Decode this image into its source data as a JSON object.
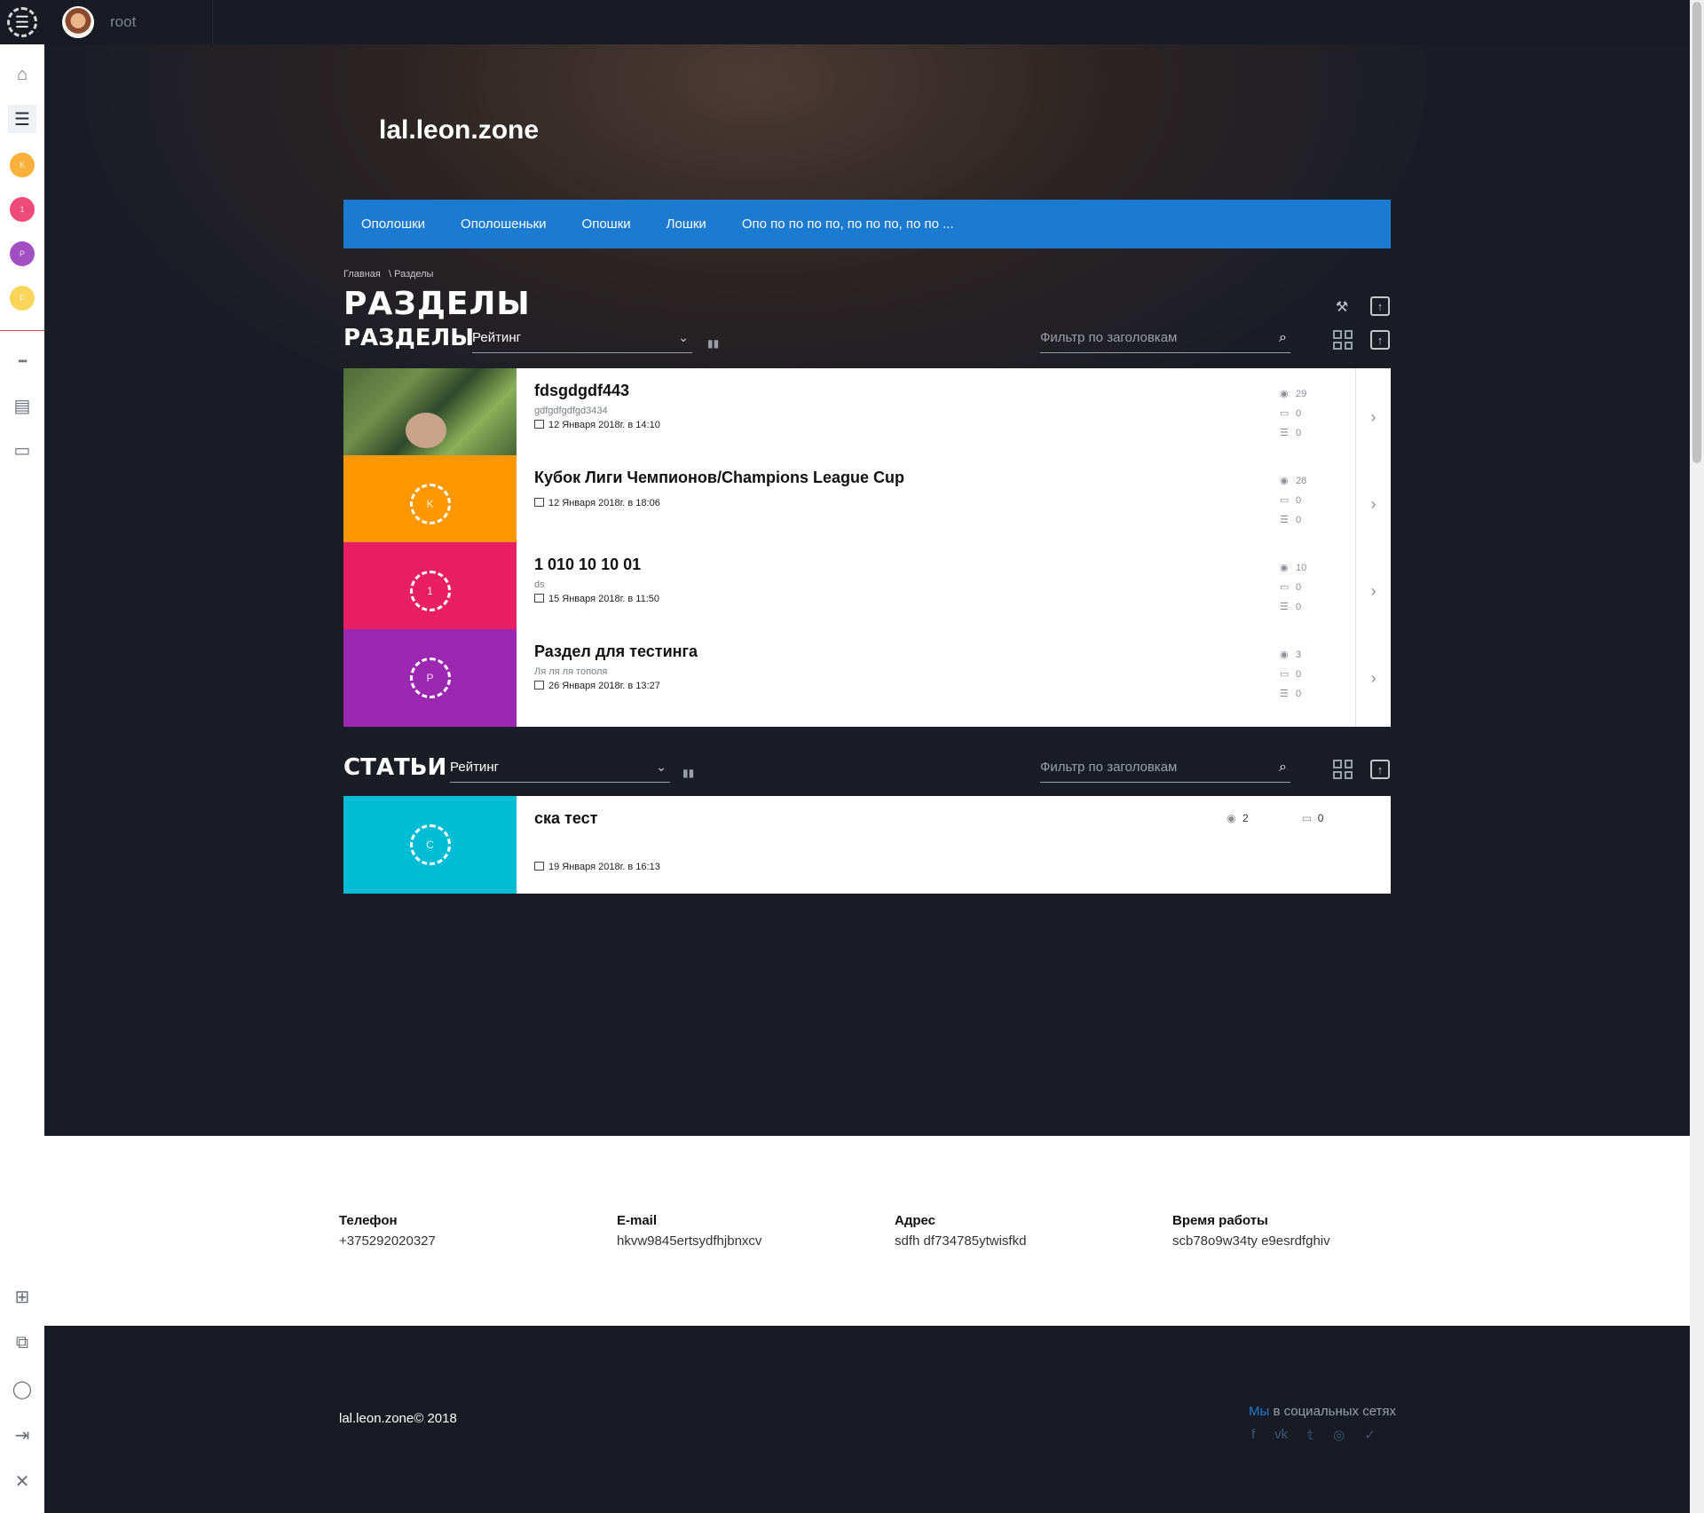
{
  "topbar": {
    "user_name": "root"
  },
  "sidebar": {
    "dots": [
      {
        "letter": "K",
        "color": "#fbb03b"
      },
      {
        "letter": "1",
        "color": "#ee4a7c"
      },
      {
        "letter": "P",
        "color": "#a24fc4"
      },
      {
        "letter": "F",
        "color": "#fbd55a"
      }
    ]
  },
  "site": {
    "title": "lal.leon.zone",
    "nav": [
      "Ополошки",
      "Ополошеньки",
      "Опошки",
      "Лошки",
      "Опо по по по по, по по по, по по ..."
    ]
  },
  "breadcrumb": {
    "home": "Главная",
    "sep": "\\",
    "current": "Разделы"
  },
  "page_title": "РАЗДЕЛЫ",
  "sections_block": {
    "title": "РАЗДЕЛЫ",
    "sort_label": "Рейтинг",
    "filter_placeholder": "Фильтр по заголовкам",
    "items": [
      {
        "title": "fdsgdgdf443",
        "subtitle": "gdfgdfgdfgd3434",
        "date": "12 Января 2018г. в 14:10",
        "views": "29",
        "comments": "0",
        "items": "0",
        "thumb": "photo",
        "letter": "",
        "color": ""
      },
      {
        "title": "Кубок Лиги Чемпионов/Champions League Cup",
        "subtitle": "",
        "date": "12 Января 2018г. в 18:06",
        "views": "28",
        "comments": "0",
        "items": "0",
        "thumb": "ring",
        "letter": "K",
        "color": "#ff9800"
      },
      {
        "title": "1 010 10 10 01",
        "subtitle": "ds",
        "date": "15 Января 2018г. в 11:50",
        "views": "10",
        "comments": "0",
        "items": "0",
        "thumb": "ring",
        "letter": "1",
        "color": "#e91e63"
      },
      {
        "title": "Раздел для тестинга",
        "subtitle": "Ля ля ля тополя",
        "date": "26 Января 2018г. в 13:27",
        "views": "3",
        "comments": "0",
        "items": "0",
        "thumb": "ring",
        "letter": "P",
        "color": "#9c27b0"
      }
    ]
  },
  "articles_block": {
    "title": "СТАТЬИ",
    "sort_label": "Рейтинг",
    "filter_placeholder": "Фильтр по заголовкам",
    "items": [
      {
        "title": "ска тест",
        "date": "19 Января 2018г. в 16:13",
        "views": "2",
        "comments": "0",
        "letter": "C",
        "color": "#00bcd4"
      }
    ]
  },
  "contacts": [
    {
      "label": "Телефон",
      "value": "+375292020327"
    },
    {
      "label": "E-mail",
      "value": "hkvw9845ertsydfhjbnxcv"
    },
    {
      "label": "Адрес",
      "value": "sdfh df734785ytwisfkd"
    },
    {
      "label": "Время работы",
      "value": "scb78o9w34ty e9esrdfghiv"
    }
  ],
  "footer": {
    "copyright": "lal.leon.zone© 2018",
    "social_highlight": "Мы",
    "social_rest": " в социальных сетях",
    "social_icons": [
      "f",
      "vk",
      "tw",
      "ig",
      "ok"
    ]
  }
}
